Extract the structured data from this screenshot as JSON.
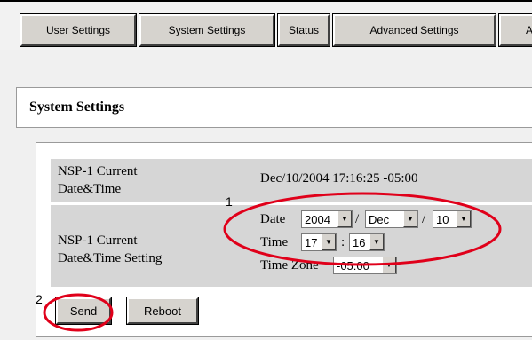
{
  "tabs": [
    {
      "label": "User Settings"
    },
    {
      "label": "System Settings"
    },
    {
      "label": "Status"
    },
    {
      "label": "Advanced Settings"
    },
    {
      "label": "A"
    }
  ],
  "section_title": "System Settings",
  "current": {
    "label": "NSP-1 Current Date&Time",
    "label_line1": "NSP-1 Current",
    "label_line2": "Date&Time",
    "value": "Dec/10/2004 17:16:25 -05:00"
  },
  "setting": {
    "label_line1": "NSP-1 Current",
    "label_line2": "Date&Time Setting",
    "date_label": "Date",
    "time_label": "Time",
    "timezone_label": "Time Zone",
    "year": "2004",
    "month": "Dec",
    "day": "10",
    "hour": "17",
    "minute": "16",
    "timezone": "-05:00",
    "date_sep": "/",
    "time_sep": ":"
  },
  "buttons": {
    "send": "Send",
    "reboot": "Reboot"
  },
  "annotations": {
    "one": "1",
    "two": "2",
    "color": "#e0001a"
  }
}
